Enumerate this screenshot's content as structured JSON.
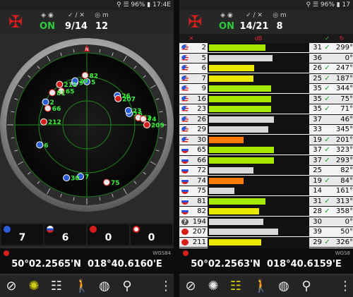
{
  "colors": {
    "accent": "#d81d1d",
    "on": "#2ecc3c",
    "bar_yellow": "#e8e800",
    "bar_green": "#a6e800",
    "bar_orange": "#ff7a00",
    "bar_white": "#d9d9d9"
  },
  "left": {
    "statusbar": {
      "icons": "⚲ ☰ 96% ▮ 17:4E"
    },
    "header": {
      "status": "ON",
      "sats": "9/14",
      "count": "12"
    },
    "radar": {
      "north": "N",
      "satellites": [
        {
          "id": "2",
          "flag": "us",
          "az": 299,
          "el": 31
        },
        {
          "id": "5",
          "flag": "us",
          "az": 0,
          "el": 36
        },
        {
          "id": "6",
          "flag": "us",
          "az": 247,
          "el": 26
        },
        {
          "id": "7",
          "flag": "us",
          "az": 187,
          "el": 25
        },
        {
          "id": "9",
          "flag": "us",
          "az": 344,
          "el": 35
        },
        {
          "id": "16",
          "flag": "us",
          "az": 75,
          "el": 35
        },
        {
          "id": "23",
          "flag": "us",
          "az": 71,
          "el": 35
        },
        {
          "id": "26",
          "flag": "us",
          "az": 46,
          "el": 37
        },
        {
          "id": "29",
          "flag": "us",
          "az": 345,
          "el": 33
        },
        {
          "id": "30",
          "flag": "us",
          "az": 201,
          "el": 19
        },
        {
          "id": "65",
          "flag": "ru",
          "az": 323,
          "el": 37
        },
        {
          "id": "66",
          "flag": "ru",
          "az": 293,
          "el": 37
        },
        {
          "id": "72",
          "flag": "ru",
          "az": 82,
          "el": 25
        },
        {
          "id": "74",
          "flag": "ru",
          "az": 84,
          "el": 19
        },
        {
          "id": "75",
          "flag": "ru",
          "az": 161,
          "el": 14
        },
        {
          "id": "81",
          "flag": "ru",
          "az": 313,
          "el": 31
        },
        {
          "id": "82",
          "flag": "ru",
          "az": 358,
          "el": 28
        },
        {
          "id": "207",
          "flag": "cn",
          "az": 50,
          "el": 39
        },
        {
          "id": "209",
          "flag": "cn",
          "az": 90,
          "el": 15
        },
        {
          "id": "211",
          "flag": "cn",
          "az": 326,
          "el": 29
        },
        {
          "id": "212",
          "flag": "cn",
          "az": 274,
          "el": 36
        }
      ]
    },
    "counters": [
      {
        "name": "gps",
        "value": "7"
      },
      {
        "name": "glonass",
        "value": "6"
      },
      {
        "name": "beidou",
        "value": "0"
      },
      {
        "name": "other",
        "value": "0"
      }
    ],
    "coords": {
      "datum": "WGS84",
      "lat": "50°02.2565'N",
      "lon": "018°40.6160'E"
    }
  },
  "right": {
    "statusbar": {
      "icons": "⚲ ☰ 96% ▮ 17"
    },
    "header": {
      "status": "ON",
      "sats": "14/21",
      "count": "8"
    },
    "rows": [
      {
        "flag": "us",
        "id": "2",
        "bar": 0.57,
        "color": "bar_green",
        "snr": "31",
        "used": true,
        "az": "299°"
      },
      {
        "flag": "us",
        "id": "5",
        "bar": 0.64,
        "color": "bar_white",
        "snr": "36",
        "used": false,
        "az": "0°"
      },
      {
        "flag": "us",
        "id": "6",
        "bar": 0.46,
        "color": "bar_yellow",
        "snr": "26",
        "used": true,
        "az": "247°"
      },
      {
        "flag": "us",
        "id": "7",
        "bar": 0.45,
        "color": "bar_yellow",
        "snr": "25",
        "used": true,
        "az": "187°"
      },
      {
        "flag": "us",
        "id": "9",
        "bar": 0.63,
        "color": "bar_green",
        "snr": "35",
        "used": true,
        "az": "344°"
      },
      {
        "flag": "us",
        "id": "16",
        "bar": 0.63,
        "color": "bar_green",
        "snr": "35",
        "used": true,
        "az": "75°"
      },
      {
        "flag": "us",
        "id": "23",
        "bar": 0.63,
        "color": "bar_green",
        "snr": "35",
        "used": true,
        "az": "71°"
      },
      {
        "flag": "us",
        "id": "26",
        "bar": 0.66,
        "color": "bar_white",
        "snr": "37",
        "used": false,
        "az": "46°"
      },
      {
        "flag": "us",
        "id": "29",
        "bar": 0.6,
        "color": "bar_white",
        "snr": "33",
        "used": false,
        "az": "345°"
      },
      {
        "flag": "us",
        "id": "30",
        "bar": 0.35,
        "color": "bar_orange",
        "snr": "19",
        "used": true,
        "az": "201°"
      },
      {
        "flag": "ru",
        "id": "65",
        "bar": 0.66,
        "color": "bar_green",
        "snr": "37",
        "used": true,
        "az": "323°"
      },
      {
        "flag": "ru",
        "id": "66",
        "bar": 0.66,
        "color": "bar_green",
        "snr": "37",
        "used": true,
        "az": "293°"
      },
      {
        "flag": "ru",
        "id": "72",
        "bar": 0.45,
        "color": "bar_white",
        "snr": "25",
        "used": false,
        "az": "82°"
      },
      {
        "flag": "ru",
        "id": "74",
        "bar": 0.35,
        "color": "bar_orange",
        "snr": "19",
        "used": true,
        "az": "84°"
      },
      {
        "flag": "ru",
        "id": "75",
        "bar": 0.26,
        "color": "bar_white",
        "snr": "14",
        "used": false,
        "az": "161°"
      },
      {
        "flag": "ru",
        "id": "81",
        "bar": 0.57,
        "color": "bar_green",
        "snr": "31",
        "used": true,
        "az": "313°"
      },
      {
        "flag": "ru",
        "id": "82",
        "bar": 0.51,
        "color": "bar_yellow",
        "snr": "28",
        "used": true,
        "az": "358°"
      },
      {
        "flag": "qz",
        "id": "194",
        "bar": 0.55,
        "color": "bar_white",
        "snr": "30",
        "used": false,
        "az": "0°"
      },
      {
        "flag": "cn",
        "id": "207",
        "bar": 0.7,
        "color": "bar_white",
        "snr": "39",
        "used": false,
        "az": "50°"
      },
      {
        "flag": "cn",
        "id": "211",
        "bar": 0.53,
        "color": "bar_yellow",
        "snr": "29",
        "used": true,
        "az": "326°"
      },
      {
        "flag": "cn",
        "id": "212",
        "bar": 0.66,
        "color": "bar_green",
        "snr": "36",
        "used": true,
        "az": "274°"
      }
    ],
    "coords": {
      "datum": "WGS8",
      "lat": "50°02.2563'N",
      "lon": "018°40.6159'E"
    }
  }
}
